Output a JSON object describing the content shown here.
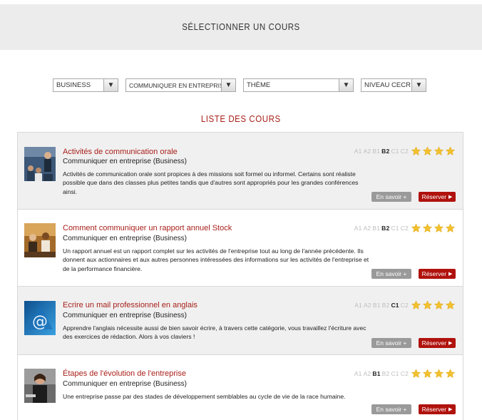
{
  "header": {
    "title": "SÉLECTIONNER UN COURS"
  },
  "filters": [
    {
      "value": "BUSINESS"
    },
    {
      "value": "COMMUNIQUER EN ENTREPRISE"
    },
    {
      "value": "THÈME"
    },
    {
      "value": "NIVEAU CECR"
    }
  ],
  "list_title": "LISTE DES COURS",
  "levels": [
    "A1",
    "A2",
    "B1",
    "B2",
    "C1",
    "C2"
  ],
  "buttons": {
    "info": "En savoir +",
    "book": "Réserver"
  },
  "courses": [
    {
      "title": "Activités de communication orale",
      "subtitle": "Communiquer en entreprise (Business)",
      "description": "Activités de communication orale sont propices à des missions soit formel ou informel. Certains sont réaliste possible que dans des classes plus petites tandis que d'autres sont appropriés pour les grandes conférences ainsi.",
      "active_level": "B2",
      "stars": 4
    },
    {
      "title": "Comment communiquer un rapport annuel Stock",
      "subtitle": "Communiquer en entreprise (Business)",
      "description": "Un rapport annuel est un rapport complet sur les activités de l'entreprise tout au long de l'année précédente. Ils donnent aux actionnaires et aux autres personnes intéressées des informations sur les activités de l'entreprise et de la performance financière.",
      "active_level": "B2",
      "stars": 4
    },
    {
      "title": "Ecrire un mail professionnel en anglais",
      "subtitle": "Communiquer en entreprise (Business)",
      "description": "Apprendre l'anglais nécessite aussi de bien savoir écrire, à travers cette catégorie, vous travaillez l'écriture avec des exercices de rédaction. Alors à vos claviers !",
      "active_level": "C1",
      "stars": 4
    },
    {
      "title": "Étapes de l'évolution de l'entreprise",
      "subtitle": "Communiquer en entreprise (Business)",
      "description": "Une entreprise passe par des stades de développement semblables au cycle de vie de la race humaine.",
      "active_level": "B1",
      "stars": 4
    }
  ],
  "colors": {
    "accent": "#a8201a",
    "book_button": "#b0120d",
    "info_button": "#9a9a9a",
    "star": "#f2c12e"
  }
}
